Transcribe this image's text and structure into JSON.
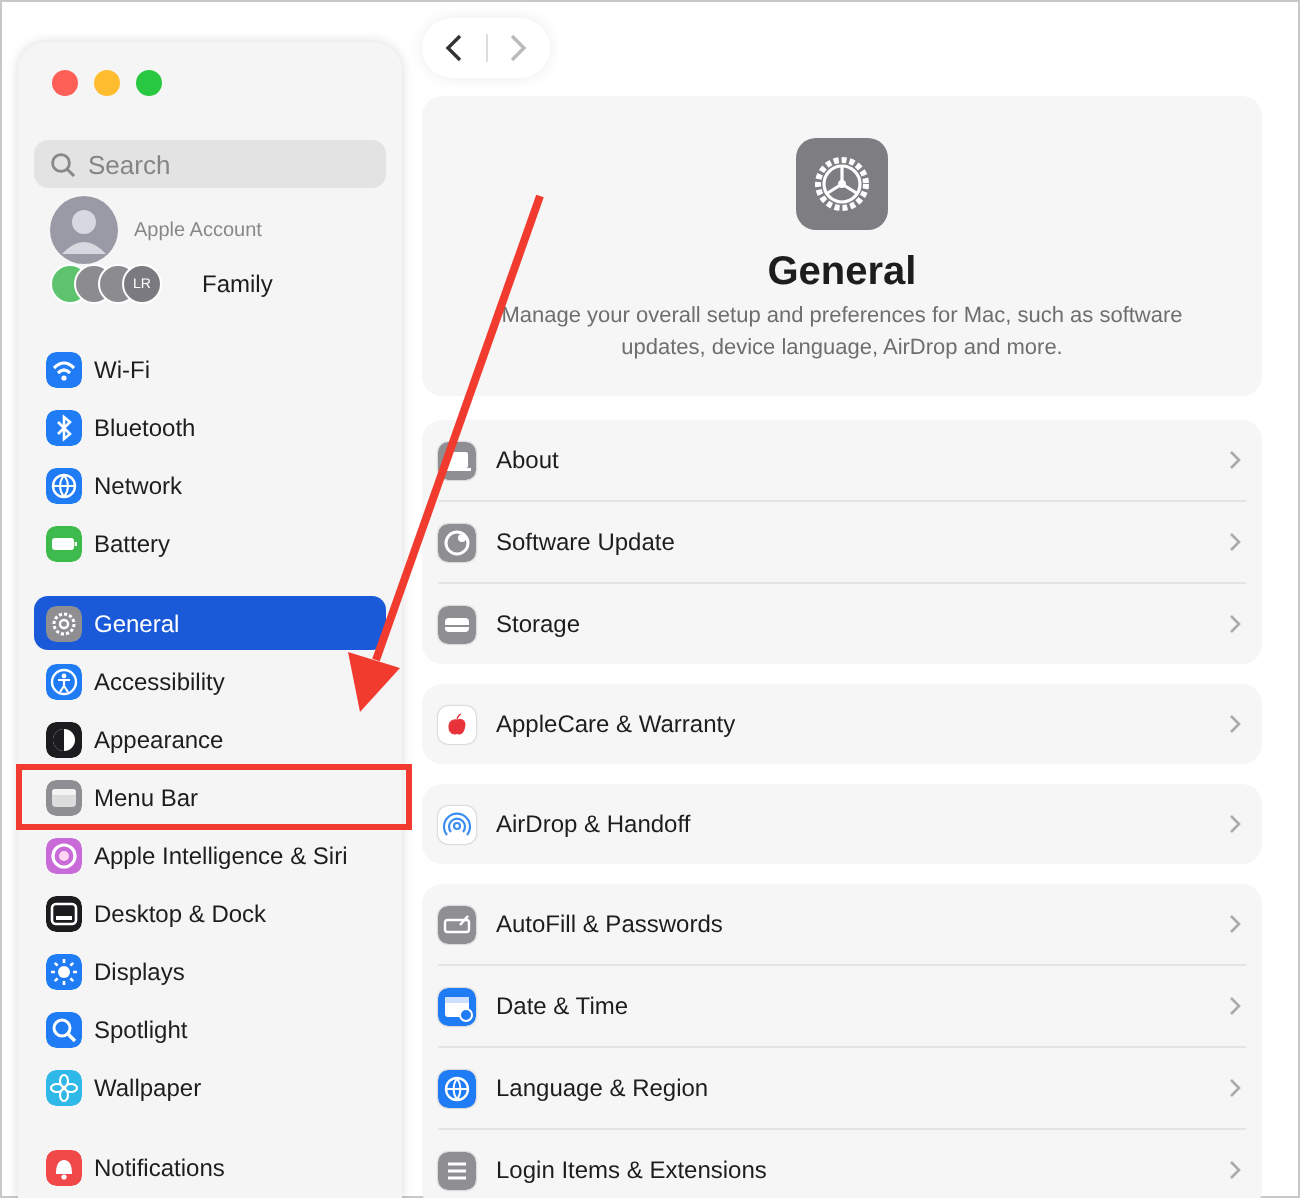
{
  "sidebar": {
    "search": {
      "placeholder": "Search"
    },
    "account": {
      "subtitle": "Apple Account"
    },
    "family": {
      "label": "Family",
      "badge": "LR"
    },
    "groups": [
      {
        "items": [
          {
            "label": "Wi-Fi",
            "selected": false,
            "color": "#1f7cf5"
          },
          {
            "label": "Bluetooth",
            "selected": false,
            "color": "#1f7cf5"
          },
          {
            "label": "Network",
            "selected": false,
            "color": "#1f7cf5"
          },
          {
            "label": "Battery",
            "selected": false,
            "color": "#3dbb4f"
          }
        ]
      },
      {
        "items": [
          {
            "label": "General",
            "selected": true,
            "color": "#8e8e93"
          },
          {
            "label": "Accessibility",
            "selected": false,
            "color": "#1f7cf5"
          },
          {
            "label": "Appearance",
            "selected": false,
            "color": "#1c1c1e"
          },
          {
            "label": "Menu Bar",
            "selected": false,
            "color": "#8e8e93",
            "highlighted": true
          },
          {
            "label": "Apple Intelligence & Siri",
            "selected": false,
            "color": "#c86bd8"
          },
          {
            "label": "Desktop & Dock",
            "selected": false,
            "color": "#1c1c1e"
          },
          {
            "label": "Displays",
            "selected": false,
            "color": "#1f7cf5"
          },
          {
            "label": "Spotlight",
            "selected": false,
            "color": "#1f7cf5"
          },
          {
            "label": "Wallpaper",
            "selected": false,
            "color": "#2fb8e8"
          }
        ]
      },
      {
        "items": [
          {
            "label": "Notifications",
            "selected": false,
            "color": "#f04848"
          }
        ]
      }
    ]
  },
  "nav": {
    "back_enabled": true,
    "forward_enabled": false
  },
  "header": {
    "title": "General",
    "description": "Manage your overall setup and preferences for Mac, such as software updates, device language, AirDrop and more."
  },
  "groups": [
    {
      "rows": [
        {
          "label": "About",
          "color": "#8e8e93"
        },
        {
          "label": "Software Update",
          "color": "#8e8e93"
        },
        {
          "label": "Storage",
          "color": "#8e8e93"
        }
      ]
    },
    {
      "rows": [
        {
          "label": "AppleCare & Warranty",
          "color": "#ffffff"
        }
      ]
    },
    {
      "rows": [
        {
          "label": "AirDrop & Handoff",
          "color": "#ffffff"
        }
      ]
    },
    {
      "rows": [
        {
          "label": "AutoFill & Passwords",
          "color": "#8e8e93"
        },
        {
          "label": "Date & Time",
          "color": "#1f7cf5"
        },
        {
          "label": "Language & Region",
          "color": "#1f7cf5"
        },
        {
          "label": "Login Items & Extensions",
          "color": "#8e8e93"
        }
      ]
    }
  ],
  "annotation": {
    "arrow": true
  }
}
